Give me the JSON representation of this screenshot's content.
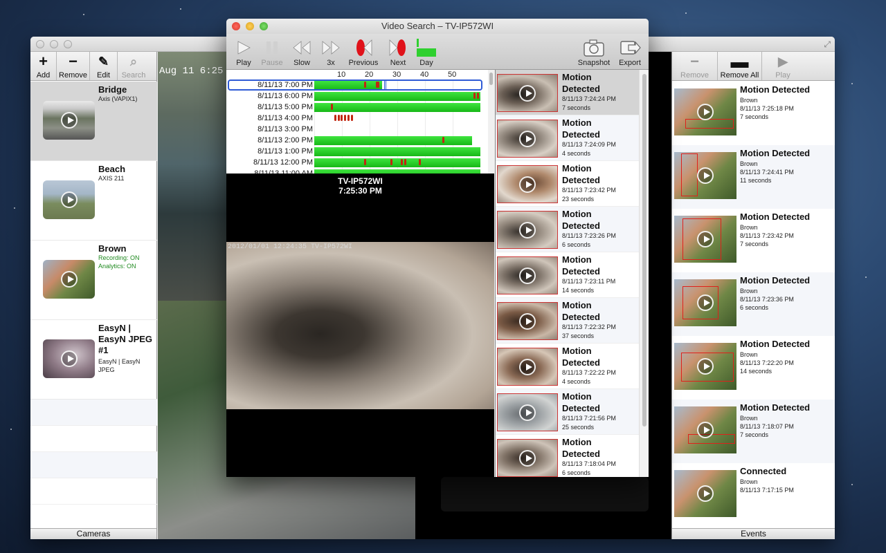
{
  "main_window": {
    "left_toolbar": [
      {
        "label": "Add",
        "icon": "plus-icon"
      },
      {
        "label": "Remove",
        "icon": "minus-icon"
      },
      {
        "label": "Edit",
        "icon": "pencil-icon"
      },
      {
        "label": "Search",
        "icon": "magnifier-icon"
      }
    ],
    "cameras": [
      {
        "name": "Bridge",
        "sub": [
          "Axis (VAPIX1)"
        ]
      },
      {
        "name": "Beach",
        "sub": [
          "AXIS 211"
        ]
      },
      {
        "name": "Brown",
        "sub": [
          "Recording: ON",
          "Analytics: ON"
        ]
      },
      {
        "name": "EasyN | EasyN JPEG #1",
        "sub": [
          "EasyN | EasyN JPEG"
        ]
      }
    ],
    "cameras_footer": "Cameras",
    "feed_timestamp": "Aug 11   6:25",
    "right_toolbar": [
      {
        "label": "Remove",
        "icon": "minus-icon"
      },
      {
        "label": "Remove All",
        "icon": "minus-bold-icon"
      },
      {
        "label": "Play",
        "icon": "play-icon"
      }
    ],
    "events": [
      {
        "title": "Motion Detected",
        "camera": "Brown",
        "time": "8/11/13 7:25:18 PM",
        "duration": "7 seconds"
      },
      {
        "title": "Motion Detected",
        "camera": "Brown",
        "time": "8/11/13 7:24:41 PM",
        "duration": "11 seconds"
      },
      {
        "title": "Motion Detected",
        "camera": "Brown",
        "time": "8/11/13 7:23:42 PM",
        "duration": "7 seconds"
      },
      {
        "title": "Motion Detected",
        "camera": "Brown",
        "time": "8/11/13 7:23:36 PM",
        "duration": "6 seconds"
      },
      {
        "title": "Motion Detected",
        "camera": "Brown",
        "time": "8/11/13 7:22:20 PM",
        "duration": "14 seconds"
      },
      {
        "title": "Motion Detected",
        "camera": "Brown",
        "time": "8/11/13 7:18:07 PM",
        "duration": "7 seconds"
      },
      {
        "title": "Connected",
        "camera": "Brown",
        "time": "8/11/13 7:17:15 PM",
        "duration": ""
      }
    ],
    "events_footer": "Events"
  },
  "dialog": {
    "title": "Video Search – TV-IP572WI",
    "toolbar": [
      {
        "label": "Play",
        "icon": "play-icon"
      },
      {
        "label": "Pause",
        "icon": "pause-icon"
      },
      {
        "label": "Slow",
        "icon": "rewind-icon"
      },
      {
        "label": "3x",
        "icon": "fast-forward-icon"
      },
      {
        "label": "Previous",
        "icon": "previous-event-icon"
      },
      {
        "label": "Next",
        "icon": "next-event-icon"
      },
      {
        "label": "Day",
        "icon": "day-chart-icon"
      },
      {
        "label": "Snapshot",
        "icon": "camera-icon"
      },
      {
        "label": "Export",
        "icon": "export-icon"
      }
    ],
    "timeline_scale": [
      "10",
      "20",
      "30",
      "40",
      "50"
    ],
    "timeline_rows": [
      {
        "label": "8/11/13 7:00 PM",
        "coverage": 0.41,
        "marks": [
          0.3,
          0.37,
          0.38
        ]
      },
      {
        "label": "8/11/13 6:00 PM",
        "coverage": 1.0,
        "marks": [
          0.96,
          0.98
        ]
      },
      {
        "label": "8/11/13 5:00 PM",
        "coverage": 1.0,
        "marks": [
          0.1
        ]
      },
      {
        "label": "8/11/13 4:00 PM",
        "coverage": 0.0,
        "marks": [
          0.12,
          0.14,
          0.16,
          0.18,
          0.2,
          0.22
        ]
      },
      {
        "label": "8/11/13 3:00 PM",
        "coverage": 0.0,
        "marks": []
      },
      {
        "label": "8/11/13 2:00 PM",
        "coverage": 0.95,
        "marks": [
          0.77
        ]
      },
      {
        "label": "8/11/13 1:00 PM",
        "coverage": 1.0,
        "marks": []
      },
      {
        "label": "8/11/13 12:00 PM",
        "coverage": 1.0,
        "marks": [
          0.3,
          0.46,
          0.52,
          0.54,
          0.63
        ]
      },
      {
        "label": "8/11/13 11:00 AM",
        "coverage": 1.0,
        "marks": []
      }
    ],
    "video_title_line1": "TV-IP572WI",
    "video_title_line2": "7:25:30 PM",
    "video_timestamp": "2012/01/01 12:24:35 TV-IP572WI",
    "events": [
      {
        "title": "Motion Detected",
        "time": "8/11/13 7:24:24 PM",
        "duration": "7 seconds"
      },
      {
        "title": "Motion Detected",
        "time": "8/11/13 7:24:09 PM",
        "duration": "4 seconds"
      },
      {
        "title": "Motion Detected",
        "time": "8/11/13 7:23:42 PM",
        "duration": "23 seconds"
      },
      {
        "title": "Motion Detected",
        "time": "8/11/13 7:23:26 PM",
        "duration": "6 seconds"
      },
      {
        "title": "Motion Detected",
        "time": "8/11/13 7:23:11 PM",
        "duration": "14 seconds"
      },
      {
        "title": "Motion Detected",
        "time": "8/11/13 7:22:32 PM",
        "duration": "37 seconds"
      },
      {
        "title": "Motion Detected",
        "time": "8/11/13 7:22:22 PM",
        "duration": "4 seconds"
      },
      {
        "title": "Motion Detected",
        "time": "8/11/13 7:21:56 PM",
        "duration": "25 seconds"
      },
      {
        "title": "Motion Detected",
        "time": "8/11/13 7:18:04 PM",
        "duration": "6 seconds"
      }
    ]
  },
  "colors": {
    "timeline_green": "#22c722",
    "motion_red": "#c2260f",
    "selection_blue": "#2f5bd6",
    "status_green": "#1f8a1f"
  }
}
